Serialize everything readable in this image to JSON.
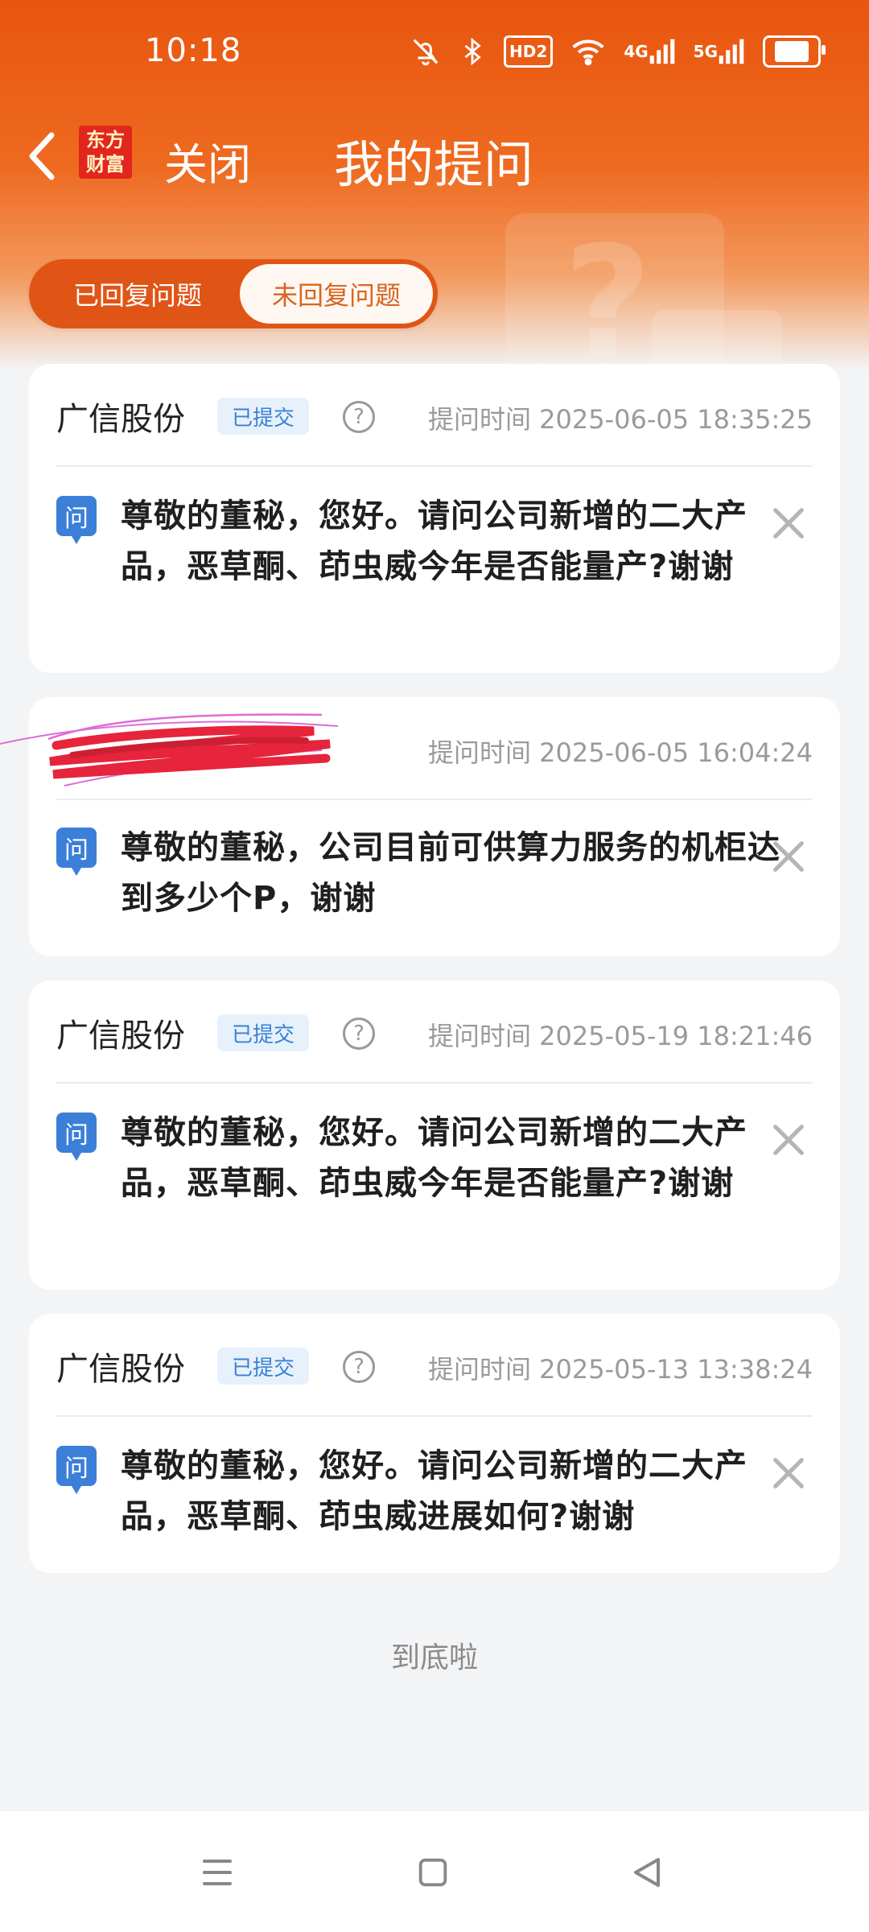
{
  "status_bar": {
    "time": "10:18",
    "hd_label": "HD2",
    "net_4g": "4G",
    "net_5g": "5G",
    "icons": [
      "mute-icon",
      "bluetooth-icon",
      "hd-icon",
      "wifi-icon",
      "signal-4g-icon",
      "signal-5g-icon",
      "battery-icon"
    ]
  },
  "nav": {
    "logo_line1": "东方",
    "logo_line2": "财富",
    "close_label": "关闭",
    "title": "我的提问"
  },
  "tabs": {
    "replied": "已回复问题",
    "unreplied": "未回复问题",
    "active": "unreplied"
  },
  "questions": [
    {
      "company": "广信股份",
      "status": "已提交",
      "time": "提问时间 2025-06-05 18:35:25",
      "q_label": "问",
      "text": "尊敬的董秘，您好。请问公司新增的二大产品，恶草酮、茚虫威今年是否能量产?谢谢"
    },
    {
      "company": "",
      "status": "",
      "time": "提问时间 2025-06-05 16:04:24",
      "q_label": "问",
      "text": "尊敬的董秘，公司目前可供算力服务的机柜达到多少个P，谢谢"
    },
    {
      "company": "广信股份",
      "status": "已提交",
      "time": "提问时间 2025-05-19 18:21:46",
      "q_label": "问",
      "text": "尊敬的董秘，您好。请问公司新增的二大产品，恶草酮、茚虫威今年是否能量产?谢谢"
    },
    {
      "company": "广信股份",
      "status": "已提交",
      "time": "提问时间 2025-05-13 13:38:24",
      "q_label": "问",
      "text": "尊敬的董秘，您好。请问公司新增的二大产品，恶草酮、茚虫威进展如何?谢谢"
    }
  ],
  "footer": {
    "end_text": "到底啦"
  },
  "colors": {
    "brand_orange": "#e8550f",
    "badge_blue": "#3a80d6",
    "question_icon_blue": "#3c7fd9"
  }
}
